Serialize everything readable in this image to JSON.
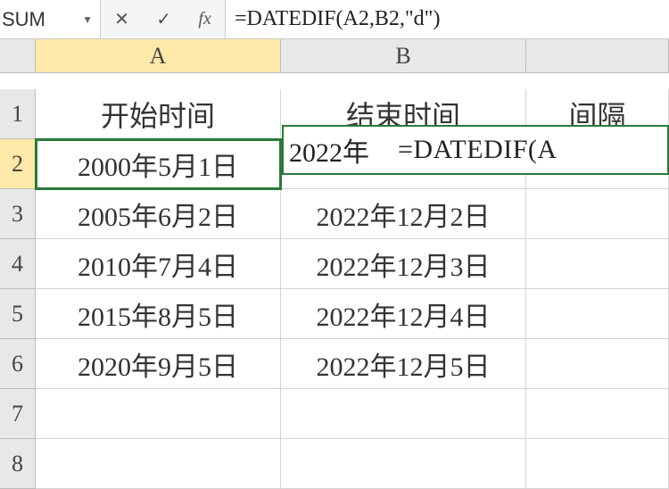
{
  "name_box": "SUM",
  "formula_bar": "=DATEDIF(A2,B2,\"d\")",
  "columns": [
    "A",
    "B",
    "C_partial"
  ],
  "col_labels": {
    "A": "A",
    "B": "B",
    "C": ""
  },
  "headers": {
    "A": "开始时间",
    "B": "结束时间",
    "C": "间隔"
  },
  "rows": [
    {
      "n": "1"
    },
    {
      "n": "2",
      "A": "2000年5月1日",
      "B": "2022年",
      "C": ""
    },
    {
      "n": "3",
      "A": "2005年6月2日",
      "B": "2022年12月2日",
      "C": ""
    },
    {
      "n": "4",
      "A": "2010年7月4日",
      "B": "2022年12月3日",
      "C": ""
    },
    {
      "n": "5",
      "A": "2015年8月5日",
      "B": "2022年12月4日",
      "C": ""
    },
    {
      "n": "6",
      "A": "2020年9月5日",
      "B": "2022年12月5日",
      "C": ""
    },
    {
      "n": "7",
      "A": "",
      "B": "",
      "C": ""
    },
    {
      "n": "8",
      "A": "",
      "B": "",
      "C": ""
    }
  ],
  "editing": {
    "b2_partial": "2022年",
    "formula_overlay": "=DATEDIF(A"
  },
  "active_cell": "A2"
}
